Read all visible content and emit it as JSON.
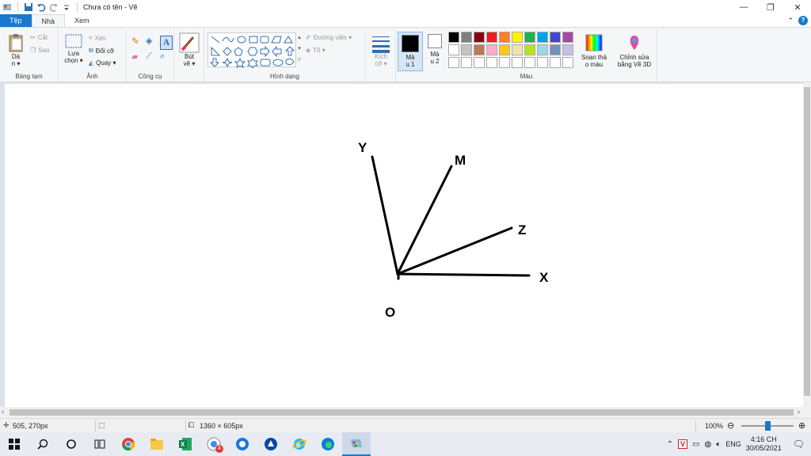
{
  "window": {
    "title": "Chưa có tên - Vẽ"
  },
  "tabs": {
    "file": "Tệp",
    "home": "Nhà",
    "view": "Xem"
  },
  "ribbon": {
    "clipboard": {
      "paste": "Dá\nn ▾",
      "cut": "Cắt",
      "copy": "Sao",
      "label": "Bảng tạm"
    },
    "image": {
      "select": "Lựa\nchọn ▾",
      "crop": "Xén",
      "resize": "Đổi cỡ",
      "rotate": "Quay ▾",
      "label": "Ảnh"
    },
    "tools": {
      "label": "Công cụ"
    },
    "brushes": {
      "label": "Bút\nvẽ ▾"
    },
    "shapes": {
      "outline": "Đường viền ▾",
      "fill": "Tô ▾",
      "label": "Hình dạng"
    },
    "size": {
      "label": "Kích\ncỡ ▾"
    },
    "colors": {
      "color1": "Mà\nu 1",
      "color2": "Mà\nu 2",
      "edit": "Soạn thả\no màu",
      "paint3d": "Chỉnh sửa\nbằng Vẽ 3D",
      "label": "Màu",
      "palette": [
        "#000000",
        "#7f7f7f",
        "#880015",
        "#ed1c24",
        "#ff7f27",
        "#fff200",
        "#22b14c",
        "#00a2e8",
        "#3f48cc",
        "#a349a4",
        "#ffffff",
        "#c3c3c3",
        "#b97a57",
        "#ffaec9",
        "#ffc90e",
        "#efe4b0",
        "#b5e61d",
        "#99d9ea",
        "#7092be",
        "#c8bfe7",
        "#ffffff",
        "#ffffff",
        "#ffffff",
        "#ffffff",
        "#ffffff",
        "#ffffff",
        "#ffffff",
        "#ffffff",
        "#ffffff",
        "#ffffff"
      ]
    }
  },
  "drawing": {
    "label_y": "Y",
    "label_m": "M",
    "label_z": "Z",
    "label_x": "X",
    "label_o": "O"
  },
  "status": {
    "cursor_pos": "505, 270px",
    "canvas_size": "1360 × 605px",
    "zoom": "100%",
    "zoom_fraction": 0.5
  },
  "taskbar": {
    "badge": "4",
    "lang": "ENG",
    "time": "4:16 CH",
    "date": "30/05/2021"
  }
}
